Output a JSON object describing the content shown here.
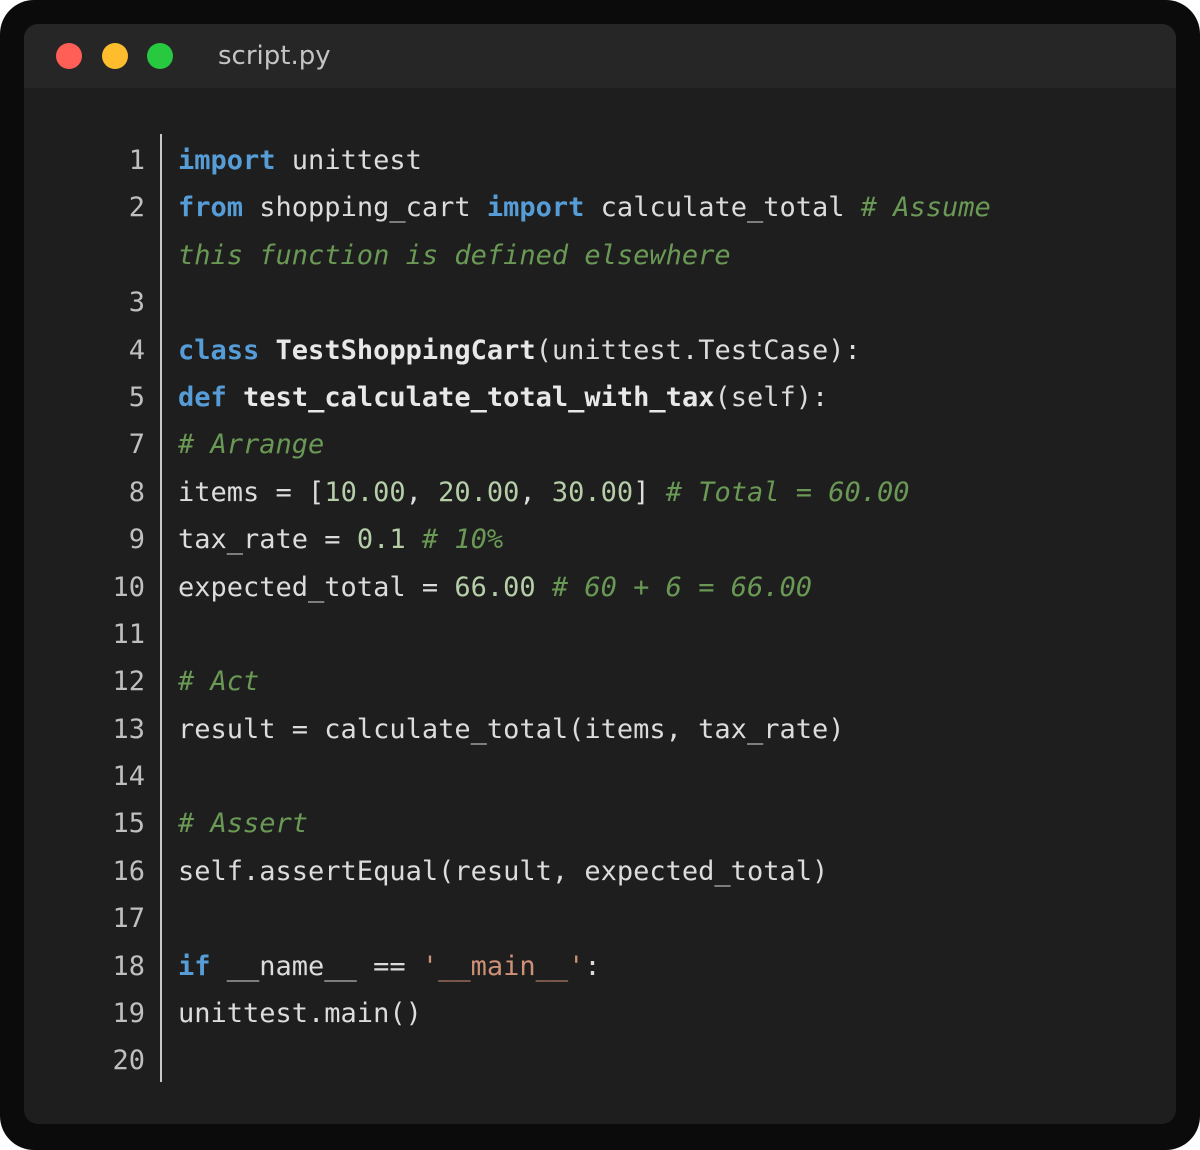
{
  "window": {
    "filename": "script.py",
    "colors": {
      "close": "#ff5f56",
      "minimize": "#ffbd2e",
      "maximize": "#27c93f"
    }
  },
  "editor": {
    "language": "python",
    "lines": [
      {
        "number": "1",
        "tokens": [
          {
            "text": "import",
            "type": "kw"
          },
          {
            "text": " unittest",
            "type": "id"
          }
        ]
      },
      {
        "number": "2",
        "tokens": [
          {
            "text": "from",
            "type": "kw"
          },
          {
            "text": " shopping_cart ",
            "type": "id"
          },
          {
            "text": "import",
            "type": "kw"
          },
          {
            "text": " calculate_total ",
            "type": "id"
          },
          {
            "text": "# Assume",
            "type": "cmt"
          }
        ]
      },
      {
        "number": "",
        "tokens": [
          {
            "text": "this function is defined elsewhere",
            "type": "cmt"
          }
        ]
      },
      {
        "number": "3",
        "tokens": []
      },
      {
        "number": "4",
        "tokens": [
          {
            "text": "class",
            "type": "kw"
          },
          {
            "text": " ",
            "type": "id"
          },
          {
            "text": "TestShoppingCart",
            "type": "cls"
          },
          {
            "text": "(unittest.TestCase):",
            "type": "id"
          }
        ]
      },
      {
        "number": "5",
        "tokens": [
          {
            "text": "def",
            "type": "kw"
          },
          {
            "text": " ",
            "type": "id"
          },
          {
            "text": "test_calculate_total_with_tax",
            "type": "cls"
          },
          {
            "text": "(self):",
            "type": "id"
          }
        ]
      },
      {
        "number": "7",
        "tokens": [
          {
            "text": "# Arrange",
            "type": "cmt"
          }
        ]
      },
      {
        "number": "8",
        "tokens": [
          {
            "text": "items = [",
            "type": "id"
          },
          {
            "text": "10.00",
            "type": "num"
          },
          {
            "text": ", ",
            "type": "id"
          },
          {
            "text": "20.00",
            "type": "num"
          },
          {
            "text": ", ",
            "type": "id"
          },
          {
            "text": "30.00",
            "type": "num"
          },
          {
            "text": "] ",
            "type": "id"
          },
          {
            "text": "# Total = 60.00",
            "type": "cmt"
          }
        ]
      },
      {
        "number": "9",
        "tokens": [
          {
            "text": "tax_rate = ",
            "type": "id"
          },
          {
            "text": "0.1",
            "type": "num"
          },
          {
            "text": " ",
            "type": "id"
          },
          {
            "text": "# 10%",
            "type": "cmt"
          }
        ]
      },
      {
        "number": "10",
        "tokens": [
          {
            "text": "expected_total = ",
            "type": "id"
          },
          {
            "text": "66.00",
            "type": "num"
          },
          {
            "text": " ",
            "type": "id"
          },
          {
            "text": "# 60 + 6 = 66.00",
            "type": "cmt"
          }
        ]
      },
      {
        "number": "11",
        "tokens": []
      },
      {
        "number": "12",
        "tokens": [
          {
            "text": "# Act",
            "type": "cmt"
          }
        ]
      },
      {
        "number": "13",
        "tokens": [
          {
            "text": "result = calculate_total(items, tax_rate)",
            "type": "id"
          }
        ]
      },
      {
        "number": "14",
        "tokens": []
      },
      {
        "number": "15",
        "tokens": [
          {
            "text": "# Assert",
            "type": "cmt"
          }
        ]
      },
      {
        "number": "16",
        "tokens": [
          {
            "text": "self.assertEqual(result, expected_total)",
            "type": "id"
          }
        ]
      },
      {
        "number": "17",
        "tokens": []
      },
      {
        "number": "18",
        "tokens": [
          {
            "text": "if",
            "type": "kw"
          },
          {
            "text": " __name__ == ",
            "type": "id"
          },
          {
            "text": "'__main__'",
            "type": "str"
          },
          {
            "text": ":",
            "type": "id"
          }
        ]
      },
      {
        "number": "19",
        "tokens": [
          {
            "text": "unittest.main()",
            "type": "id"
          }
        ]
      },
      {
        "number": "20",
        "tokens": []
      }
    ]
  }
}
